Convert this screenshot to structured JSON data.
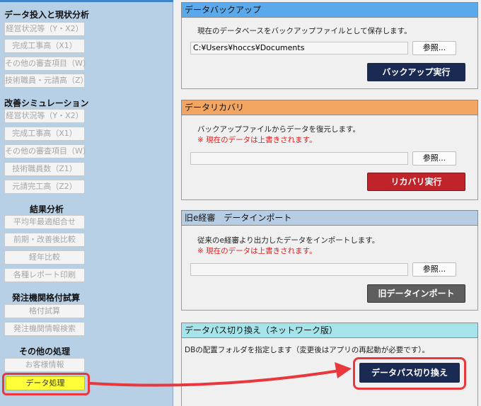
{
  "sidebar": {
    "group1": {
      "title": "データ投入と現状分析",
      "items": [
        "経営状況等（Y・X2）",
        "完成工事高（X1）",
        "その他の審査項目（W）",
        "技術職員・元請高（Z）"
      ]
    },
    "group2": {
      "title": "改善シミュレーション",
      "items": [
        "経営状況等（Y・X2）",
        "完成工事高（X1）",
        "その他の審査項目（W）",
        "技術職員数（Z1）",
        "元請完工高（Z2）"
      ]
    },
    "group3": {
      "title": "結果分析",
      "items": [
        "平均年最適組合せ",
        "前期・改善後比較",
        "経年比較",
        "各種レポート印刷"
      ]
    },
    "group4": {
      "title": "発注機関格付試算",
      "items": [
        "格付試算",
        "発注機関情報検索"
      ]
    },
    "group5": {
      "title": "その他の処理",
      "items": [
        "お客様情報",
        "データ処理"
      ]
    }
  },
  "backup": {
    "title": "データバックアップ",
    "description": "現在のデータベースをバックアップファイルとして保存します。",
    "path": "C:¥Users¥hoccs¥Documents",
    "browse_label": "参照...",
    "action_label": "バックアップ実行"
  },
  "recovery": {
    "title": "データリカバリ",
    "description": "バックアップファイルからデータを復元します。",
    "warning": "※ 現在のデータは上書きされます。",
    "path": "",
    "browse_label": "参照...",
    "action_label": "リカバリ実行"
  },
  "import": {
    "title": "旧e経審　データインポート",
    "description": "従来のe経審より出力したデータをインポートします。",
    "warning": "※ 現在のデータは上書きされます。",
    "path": "",
    "browse_label": "参照...",
    "action_label": "旧データインポート"
  },
  "datapath": {
    "title": "データパス切り換え（ネットワーク版）",
    "description": "DBの配置フォルダを指定します（変更後はアプリの再起動が必要です）。",
    "action_label": "データパス切り換え"
  },
  "colors": {
    "backup_header": "#5aa9ec",
    "recovery_header": "#f3a661",
    "import_header": "#b6cde4",
    "datapath_header": "#a5e4ea",
    "active_item": "#ffff3a",
    "highlight": "#e8383d",
    "primary_button": "#1b2a52",
    "danger_button": "#c0232a",
    "import_button": "#5e5e5e"
  }
}
